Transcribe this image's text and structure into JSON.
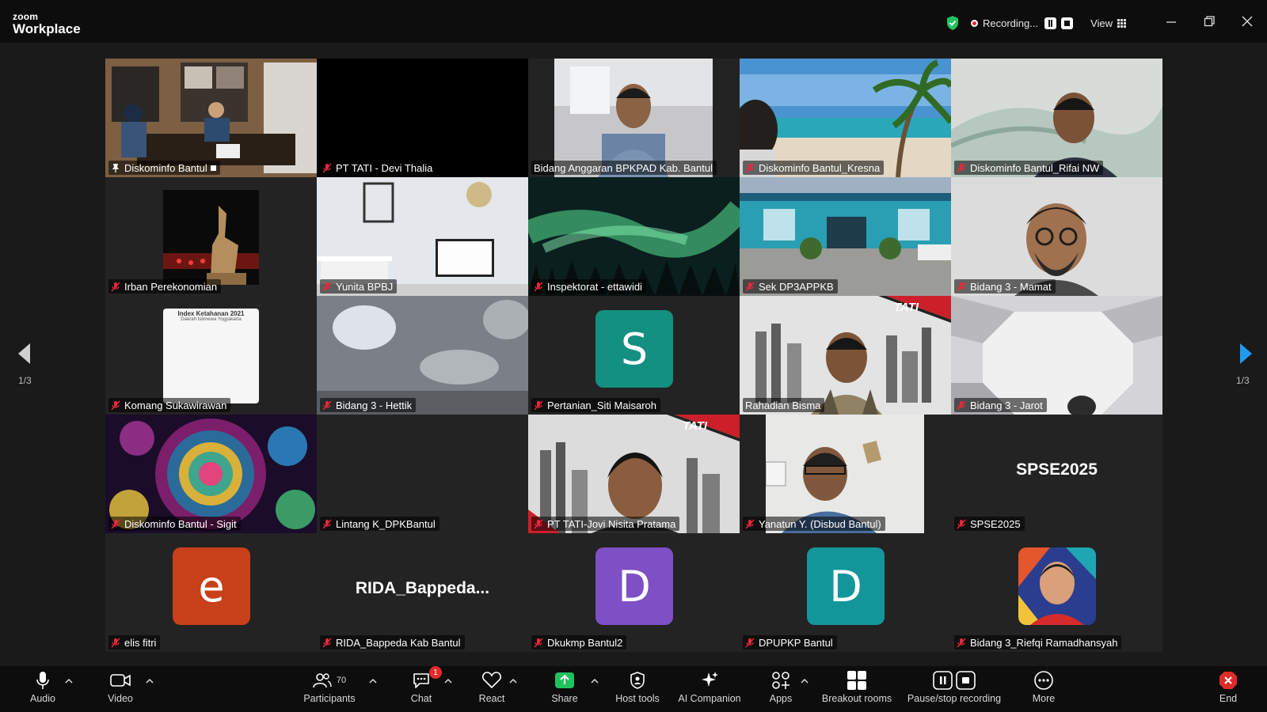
{
  "app": {
    "brand_top": "zoom",
    "brand_bottom": "Workplace"
  },
  "topbar": {
    "recording_label": "Recording...",
    "view_label": "View"
  },
  "pagination": {
    "left": "1/3",
    "right": "1/3"
  },
  "colors": {
    "active_speaker": "#2ddc82",
    "recording": "#e8283b",
    "share": "#21c25e",
    "end": "#e02b2b"
  },
  "participants": [
    {
      "name": "Diskominfo Bantul",
      "video": "office-meeting",
      "pinned": true,
      "active": true
    },
    {
      "name": "PT TATI - Devi Thalia",
      "video": "black"
    },
    {
      "name": "Bidang Anggaran BPKPAD Kab. Bantul",
      "video": "man-window"
    },
    {
      "name": "Diskominfo Bantul_Kresna",
      "video": "beach"
    },
    {
      "name": "Diskominfo Bantul_Rifai NW",
      "video": "man-white-room"
    },
    {
      "name": "Irban Perekonomian",
      "video": "statue-night"
    },
    {
      "name": "Yunita BPBJ",
      "video": "desk-room"
    },
    {
      "name": "Inspektorat - ettawidi",
      "video": "aurora"
    },
    {
      "name": "Sek DP3APPKB",
      "video": "blue-building"
    },
    {
      "name": "Bidang 3 - Mamat",
      "video": "cartoon-avatar"
    },
    {
      "name": "Komang Sukawirawan",
      "video": "document",
      "doc_title": "Index Ketahanan 2021",
      "doc_sub": "Daerah Istimewa Yogyakarta"
    },
    {
      "name": "Bidang 3 - Hettik",
      "video": "blurred-ceiling"
    },
    {
      "name": "Pertanian_Siti Maisaroh",
      "video": "avatar",
      "initial": "S",
      "color": "#13907f"
    },
    {
      "name": "Rahadian Bisma",
      "video": "tati-city",
      "logo_text": "TATI"
    },
    {
      "name": "Bidang 3 - Jarot",
      "video": "white-tunnel"
    },
    {
      "name": "Diskominfo Bantul - Sigit",
      "video": "kaleidoscope"
    },
    {
      "name": "Lintang K_DPKBantul",
      "video": "none"
    },
    {
      "name": "PT TATI-Jovi Nisita Pratama",
      "video": "tati-city-young",
      "logo_text": "TATI"
    },
    {
      "name": "Yanatun Y. (Disbud Bantul)",
      "video": "man-selfie"
    },
    {
      "name": "SPSE2025",
      "video": "name",
      "display_name": "SPSE2025"
    },
    {
      "name": "elis fitri",
      "video": "avatar",
      "initial": "e",
      "color": "#c8401a"
    },
    {
      "name": "RIDA_Bappeda Kab Bantul",
      "video": "name",
      "display_name": "RIDA_Bappeda..."
    },
    {
      "name": "Dkukmp Bantul2",
      "video": "avatar",
      "initial": "D",
      "color": "#7e4fc5"
    },
    {
      "name": "DPUPKP Bantul",
      "video": "avatar",
      "initial": "D",
      "color": "#13969a"
    },
    {
      "name": "Bidang 3_Riefqi Ramadhansyah",
      "video": "illustrated-portrait"
    }
  ],
  "toolbar": {
    "audio": "Audio",
    "video": "Video",
    "participants": "Participants",
    "participants_count": "70",
    "chat": "Chat",
    "chat_badge": "1",
    "react": "React",
    "share": "Share",
    "host_tools": "Host tools",
    "ai_companion": "AI Companion",
    "apps": "Apps",
    "breakout_rooms": "Breakout rooms",
    "pause_stop_recording": "Pause/stop recording",
    "more": "More",
    "end": "End"
  }
}
